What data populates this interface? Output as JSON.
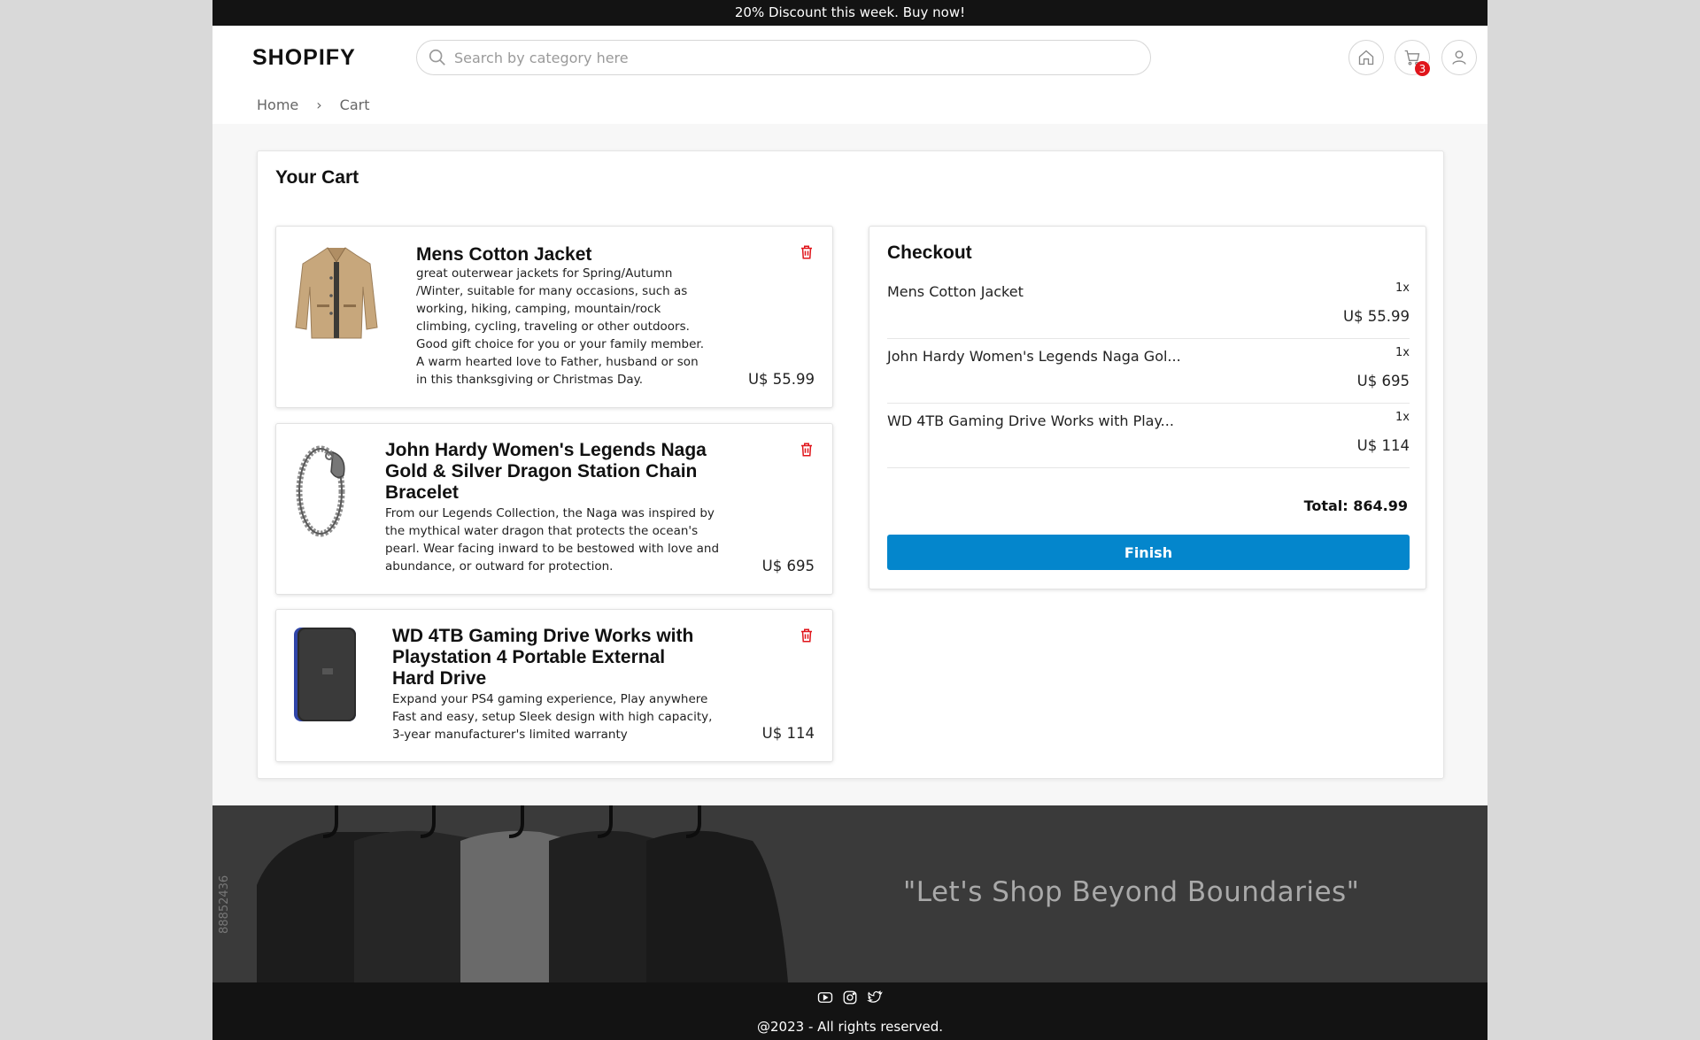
{
  "announcement": "20% Discount this week. Buy now!",
  "header": {
    "logo": "SHOPIFY",
    "search_placeholder": "Search by category here",
    "cart_count": "3"
  },
  "breadcrumb": {
    "home": "Home",
    "separator": "›",
    "current": "Cart"
  },
  "cart": {
    "title": "Your Cart",
    "items": [
      {
        "title": "Mens Cotton Jacket",
        "description": "great outerwear jackets for Spring/Autumn /Winter, suitable for many occasions, such as working, hiking, camping, mountain/rock climbing, cycling, traveling or other outdoors. Good gift choice for you or your family member. A warm hearted love to Father, husband or son in this thanksgiving or Christmas Day.",
        "price": "U$ 55.99",
        "image_icon": "jacket-image"
      },
      {
        "title": "John Hardy Women's Legends Naga Gold & Silver Dragon Station Chain Bracelet",
        "description": "From our Legends Collection, the Naga was inspired by the mythical water dragon that protects the ocean's pearl. Wear facing inward to be bestowed with love and abundance, or outward for protection.",
        "price": "U$ 695",
        "image_icon": "bracelet-image"
      },
      {
        "title": "WD 4TB Gaming Drive Works with Playstation 4 Portable External Hard Drive",
        "description": "Expand your PS4 gaming experience, Play anywhere Fast and easy, setup Sleek design with high capacity, 3-year manufacturer's limited warranty",
        "price": "U$ 114",
        "image_icon": "hard-drive-image"
      }
    ]
  },
  "checkout": {
    "title": "Checkout",
    "lines": [
      {
        "name": "Mens Cotton Jacket",
        "qty": "1x",
        "price": "U$ 55.99"
      },
      {
        "name": "John Hardy Women's Legends Naga Gol...",
        "qty": "1x",
        "price": "U$ 695"
      },
      {
        "name": "WD 4TB Gaming Drive Works with Play...",
        "qty": "1x",
        "price": "U$ 114"
      }
    ],
    "total": "Total: 864.99",
    "finish_label": "Finish"
  },
  "banner": {
    "quote": "\"Let's Shop Beyond Boundaries\"",
    "image_id": "88852436"
  },
  "footer": {
    "socials": [
      "youtube-icon",
      "instagram-icon",
      "twitter-icon"
    ],
    "copyright": "@2023 - All rights reserved."
  },
  "colors": {
    "accent": "#0486cc",
    "badge": "#e0151b",
    "trash": "#e0151b",
    "topbar": "#131313"
  }
}
